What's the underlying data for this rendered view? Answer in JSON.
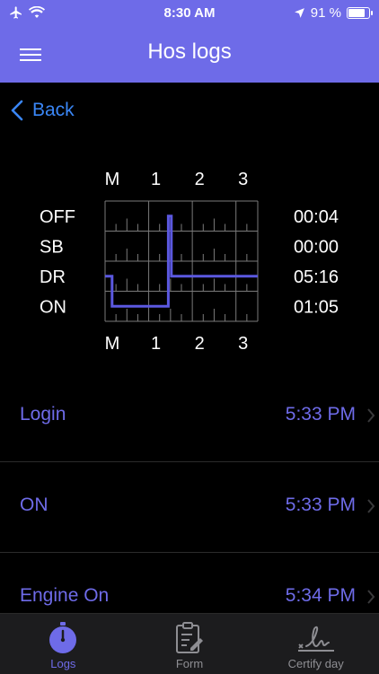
{
  "status_bar": {
    "time": "8:30 AM",
    "battery_text": "91 %",
    "battery_level": 0.91
  },
  "nav": {
    "title": "Hos logs",
    "back_label": "Back"
  },
  "colors": {
    "accent": "#6E6BE8",
    "link": "#3A86F5",
    "background": "#000000"
  },
  "chart_data": {
    "type": "line",
    "x_tick_labels": [
      "M",
      "1",
      "2",
      "3"
    ],
    "status_labels": [
      "OFF",
      "SB",
      "DR",
      "ON"
    ],
    "totals": [
      "00:04",
      "00:00",
      "05:16",
      "01:05"
    ],
    "x_range_hours": [
      0,
      3.5
    ],
    "grid": true,
    "step_series": {
      "name": "",
      "hours": [
        0,
        0.16,
        0.16,
        0.45,
        0.45,
        1.45,
        1.45,
        1.52,
        1.52,
        3.5
      ],
      "status_index": [
        2,
        2,
        3,
        3,
        3,
        3,
        0,
        0,
        2,
        2
      ]
    }
  },
  "log_entries": [
    {
      "label": "Login",
      "time": "5:33 PM"
    },
    {
      "label": "ON",
      "time": "5:33 PM"
    },
    {
      "label": "Engine On",
      "time": "5:34 PM"
    }
  ],
  "tabs": [
    {
      "label": "Logs",
      "icon": "stopwatch-icon",
      "active": true
    },
    {
      "label": "Form",
      "icon": "clipboard-edit-icon",
      "active": false
    },
    {
      "label": "Certify day",
      "icon": "signature-icon",
      "active": false
    }
  ]
}
